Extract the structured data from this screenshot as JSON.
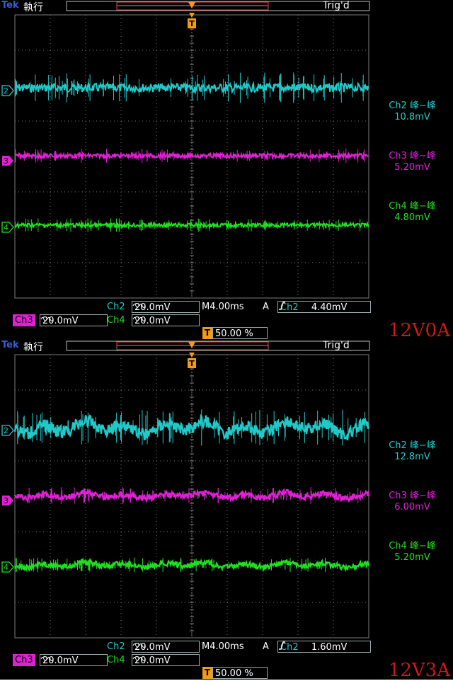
{
  "colors": {
    "ch2": "#21c9c9",
    "ch3": "#e120d6",
    "ch4": "#1fe01f",
    "trigger": "#f39a1a",
    "grid": "#7a7a7a",
    "caption": "#d01818",
    "bg": "#000000"
  },
  "panels": [
    {
      "logo": "Tek",
      "run_state": "執行",
      "trigger_status": "Trig'd",
      "channel_markers": [
        "2",
        "3",
        "4"
      ],
      "measurements": [
        {
          "label": "Ch2 峰−峰",
          "value": "10.8mV"
        },
        {
          "label": "Ch3 峰−峰",
          "value": "5.20mV"
        },
        {
          "label": "Ch4 峰−峰",
          "value": "4.80mV"
        }
      ],
      "settings": {
        "ch2_name": "Ch2",
        "ch2_scale": "20.0mV",
        "ch3_name": "Ch3",
        "ch3_scale": "20.0mV",
        "ch4_name": "Ch4",
        "ch4_scale": "20.0mV",
        "timebase": "M4.00ms",
        "trigger_mode": "A",
        "trigger_source": "Ch2",
        "trigger_level": "4.40mV",
        "trigger_chip": "T",
        "trigger_position": "50.00 %"
      },
      "caption": "12V0A"
    },
    {
      "logo": "Tek",
      "run_state": "執行",
      "trigger_status": "Trig'd",
      "channel_markers": [
        "2",
        "3",
        "4"
      ],
      "measurements": [
        {
          "label": "Ch2 峰−峰",
          "value": "12.8mV"
        },
        {
          "label": "Ch3 峰−峰",
          "value": "6.00mV"
        },
        {
          "label": "Ch4 峰−峰",
          "value": "5.20mV"
        }
      ],
      "settings": {
        "ch2_name": "Ch2",
        "ch2_scale": "20.0mV",
        "ch3_name": "Ch3",
        "ch3_scale": "20.0mV",
        "ch4_name": "Ch4",
        "ch4_scale": "20.0mV",
        "timebase": "M4.00ms",
        "trigger_mode": "A",
        "trigger_source": "Ch2",
        "trigger_level": "1.60mV",
        "trigger_chip": "T",
        "trigger_position": "50.00 %"
      },
      "caption": "12V3A"
    }
  ],
  "chart_data": [
    {
      "type": "line",
      "grid": true,
      "x_divisions": 10,
      "y_divisions": 8,
      "series": [
        {
          "name": "Ch2",
          "scale_mV_per_div": 20.0,
          "peak_to_peak_mV": 10.8
        },
        {
          "name": "Ch3",
          "scale_mV_per_div": 20.0,
          "peak_to_peak_mV": 5.2
        },
        {
          "name": "Ch4",
          "scale_mV_per_div": 20.0,
          "peak_to_peak_mV": 4.8
        }
      ],
      "timebase": "M4.00ms"
    },
    {
      "type": "line",
      "grid": true,
      "x_divisions": 10,
      "y_divisions": 8,
      "series": [
        {
          "name": "Ch2",
          "scale_mV_per_div": 20.0,
          "peak_to_peak_mV": 12.8
        },
        {
          "name": "Ch3",
          "scale_mV_per_div": 20.0,
          "peak_to_peak_mV": 6.0
        },
        {
          "name": "Ch4",
          "scale_mV_per_div": 20.0,
          "peak_to_peak_mV": 5.2
        }
      ],
      "timebase": "M4.00ms"
    }
  ]
}
